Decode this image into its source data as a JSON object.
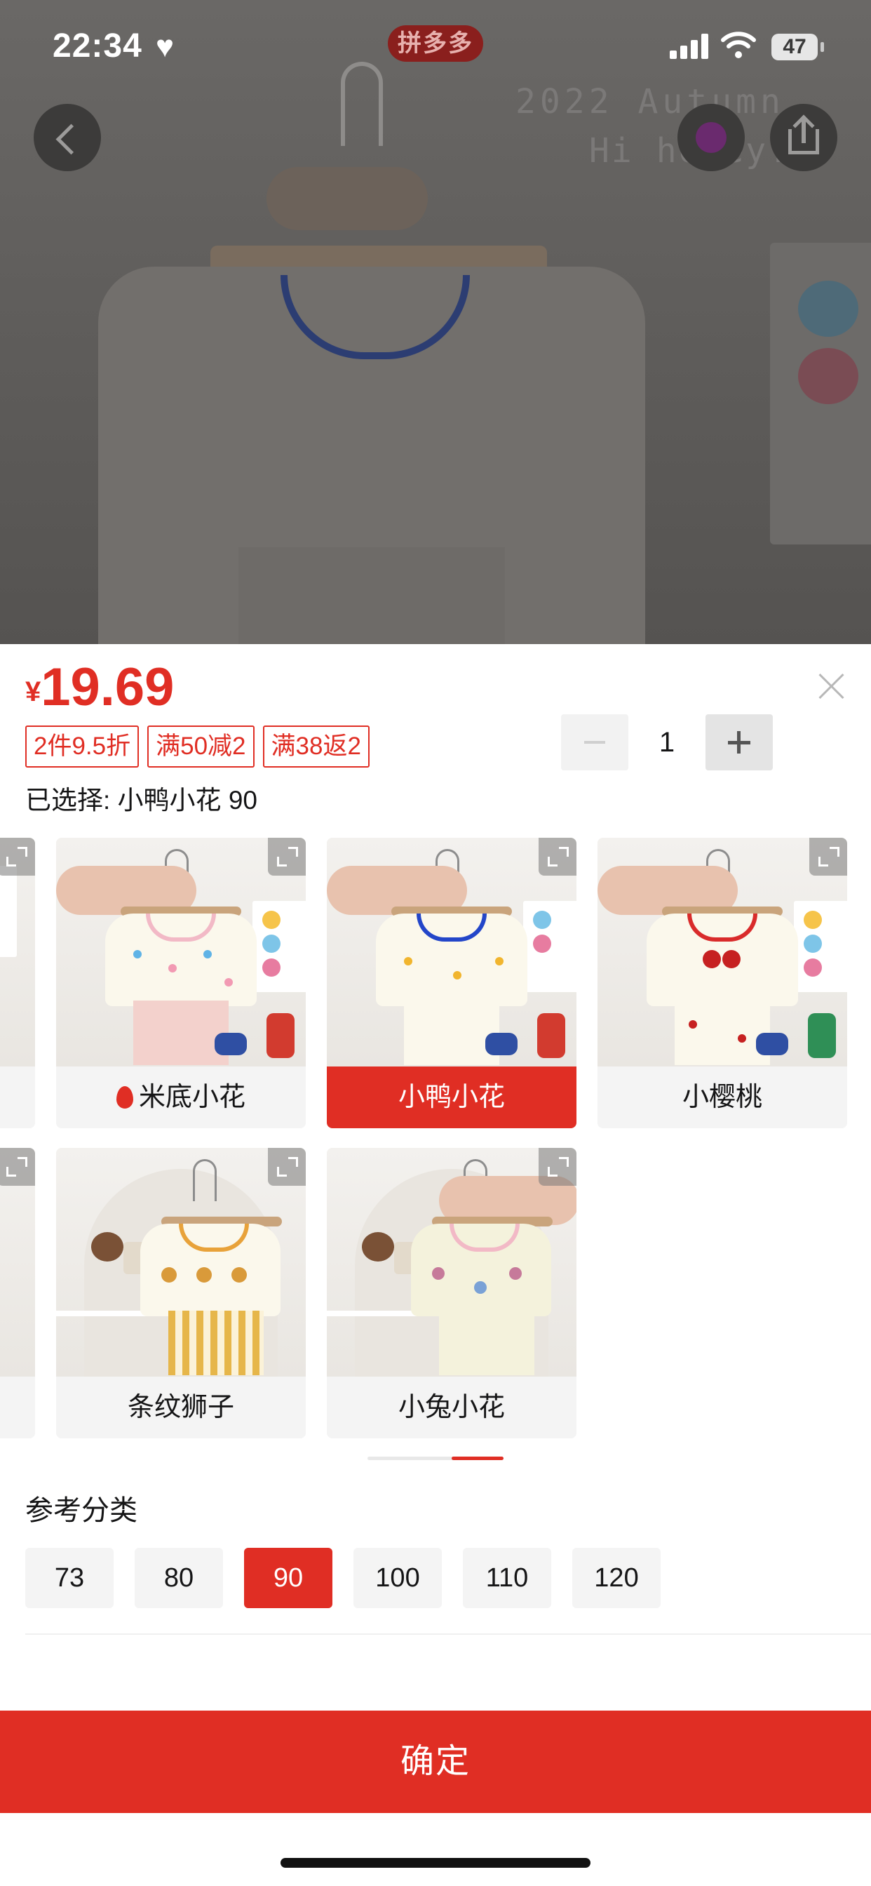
{
  "status_bar": {
    "time": "22:34",
    "battery": "47"
  },
  "header": {
    "app_logo": "拼多多"
  },
  "hero": {
    "poster_text": [
      "2022 Autumn",
      "Hi honey!"
    ]
  },
  "sheet": {
    "price_symbol": "¥",
    "price": "19.69",
    "promo_tags": [
      "2件9.5折",
      "满50减2",
      "满38返2"
    ],
    "quantity": "1",
    "selected_text": "已选择: 小鸭小花 90"
  },
  "styles": {
    "items": [
      {
        "label": "米底小花",
        "hot": true
      },
      {
        "label": "小鸭小花",
        "selected": true
      },
      {
        "label": "小樱桃"
      },
      {
        "label": "条纹狮子"
      },
      {
        "label": "小兔小花"
      }
    ]
  },
  "size": {
    "title": "参考分类",
    "options": [
      "73",
      "80",
      "90",
      "100",
      "110",
      "120"
    ],
    "selected": "90"
  },
  "footer": {
    "confirm_label": "确定"
  },
  "colors": {
    "accent": "#e02e24",
    "chip_bg": "#f4f4f4"
  },
  "icons": [
    "heart-icon",
    "signal-icon",
    "wifi-icon",
    "battery-icon",
    "back-arrow-icon",
    "share-icon",
    "close-icon",
    "minus-icon",
    "plus-icon",
    "expand-icon",
    "fire-icon"
  ]
}
